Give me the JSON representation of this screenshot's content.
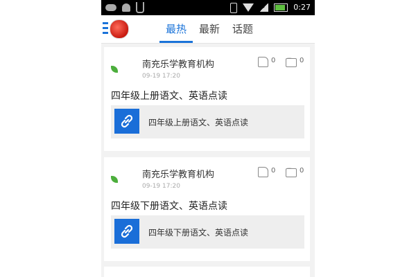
{
  "status_bar": {
    "time": "0:27",
    "left_icons": [
      "cloud-icon",
      "android-icon",
      "usb-icon"
    ],
    "right_icons": [
      "vibrate-icon",
      "wifi-icon",
      "signal-icon",
      "battery-icon"
    ]
  },
  "header": {
    "tabs": [
      {
        "label": "最热",
        "active": true
      },
      {
        "label": "最新",
        "active": false
      },
      {
        "label": "话题",
        "active": false
      }
    ],
    "accent_color": "#1a73d9"
  },
  "feed": {
    "posts": [
      {
        "org_name": "南充乐学教育机构",
        "time": "09-19 17:20",
        "likes": "0",
        "comments": "0",
        "title": "四年级上册语文、英语点读",
        "link_text": "四年级上册语文、英语点读"
      },
      {
        "org_name": "南充乐学教育机构",
        "time": "09-19 17:20",
        "likes": "0",
        "comments": "0",
        "title": "四年级下册语文、英语点读",
        "link_text": "四年级下册语文、英语点读"
      }
    ]
  }
}
